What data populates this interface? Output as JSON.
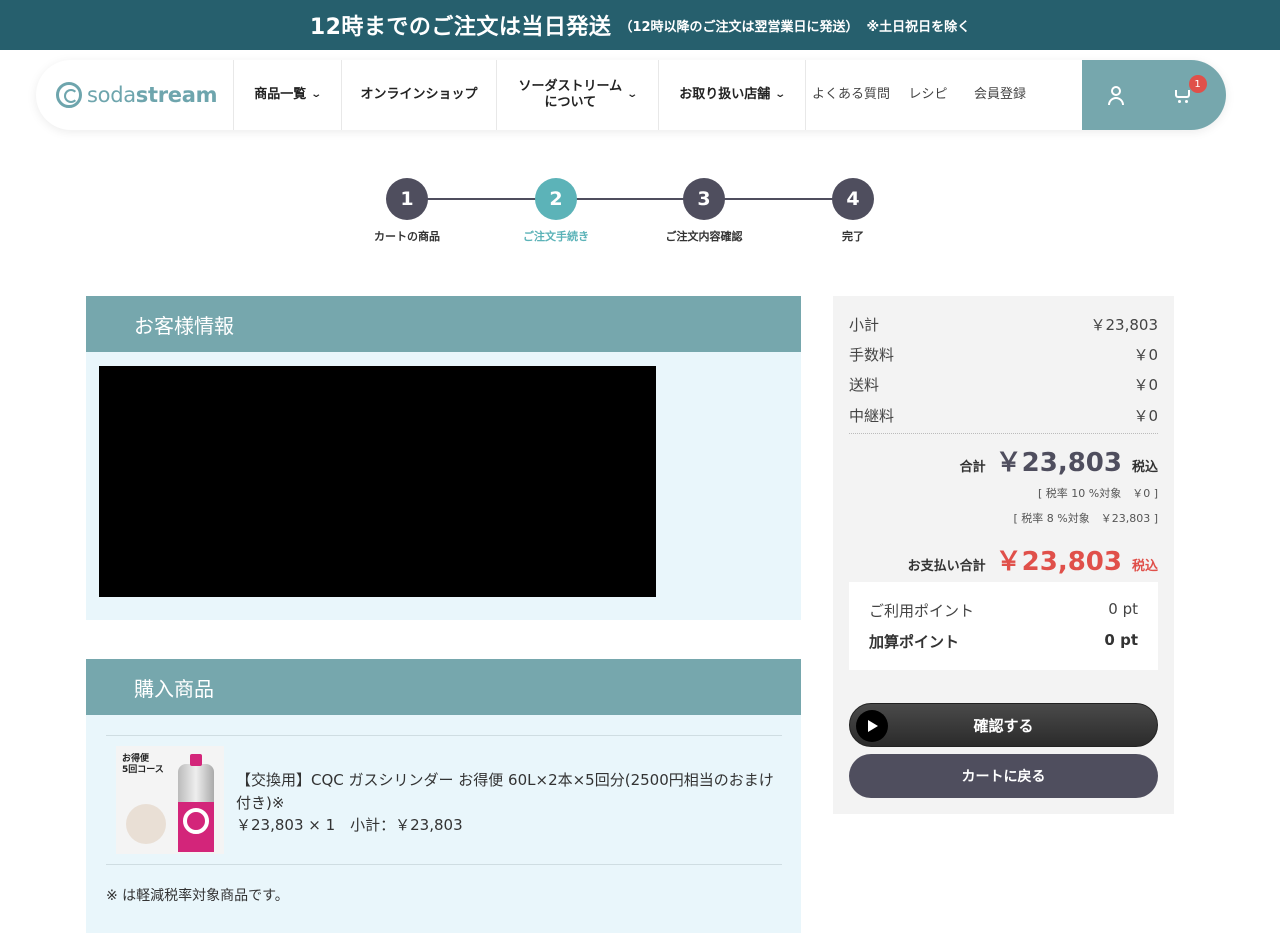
{
  "topbar": {
    "main": "12時までのご注文は当日発送",
    "sub": "（12時以降のご注文は翌営業日に発送）",
    "note": "※土日祝日を除く"
  },
  "header": {
    "logo_regular": "soda",
    "logo_bold": "stream",
    "nav": [
      {
        "label": "商品一覧",
        "has_dropdown": true
      },
      {
        "label": "オンラインショップ",
        "has_dropdown": false
      },
      {
        "label": "ソーダストリーム",
        "label2": "について",
        "has_dropdown": true
      },
      {
        "label": "お取り扱い店舗",
        "has_dropdown": true
      },
      {
        "label": "よくある質問"
      },
      {
        "label": "レシピ"
      },
      {
        "label": "会員登録"
      }
    ],
    "cart_count": "1",
    "accent_color": "#76a7ad"
  },
  "page_title": "ご注文手続き",
  "steps": [
    {
      "number": "1",
      "label": "カートの商品"
    },
    {
      "number": "2",
      "label": "ご注文手続き",
      "active": true
    },
    {
      "number": "3",
      "label": "ご注文内容確認"
    },
    {
      "number": "4",
      "label": "完了"
    }
  ],
  "customer": {
    "heading": "お客様情報"
  },
  "items": {
    "heading": "購入商品",
    "product": {
      "thumb_tag1": "お得便",
      "thumb_tag2": "5回コース",
      "name": "【交換用】CQC ガスシリンダー お得便 60L×2本×5回分(2500円相当のおまけ付き)※",
      "price_line": "￥23,803 × 1　小計：￥23,803"
    },
    "note": "※ は軽減税率対象商品です。"
  },
  "summary": {
    "rows": [
      {
        "label": "小計",
        "value": "￥23,803"
      },
      {
        "label": "手数料",
        "value": "￥0"
      },
      {
        "label": "送料",
        "value": "￥0"
      },
      {
        "label": "中継料",
        "value": "￥0"
      }
    ],
    "total_label": "合計",
    "total_value": "￥23,803",
    "tax_suffix": "税込",
    "tax10": "[ 税率 10 %対象　￥0 ]",
    "tax8": "[ 税率 8 %対象　￥23,803 ]",
    "pay_label": "お支払い合計",
    "pay_value": "￥23,803",
    "points": [
      {
        "label": "ご利用ポイント",
        "value": "0 pt"
      },
      {
        "label": "加算ポイント",
        "value": "0 pt"
      }
    ],
    "confirm_label": "確認する",
    "back_label": "カートに戻る",
    "pay_color": "#e0504a"
  }
}
